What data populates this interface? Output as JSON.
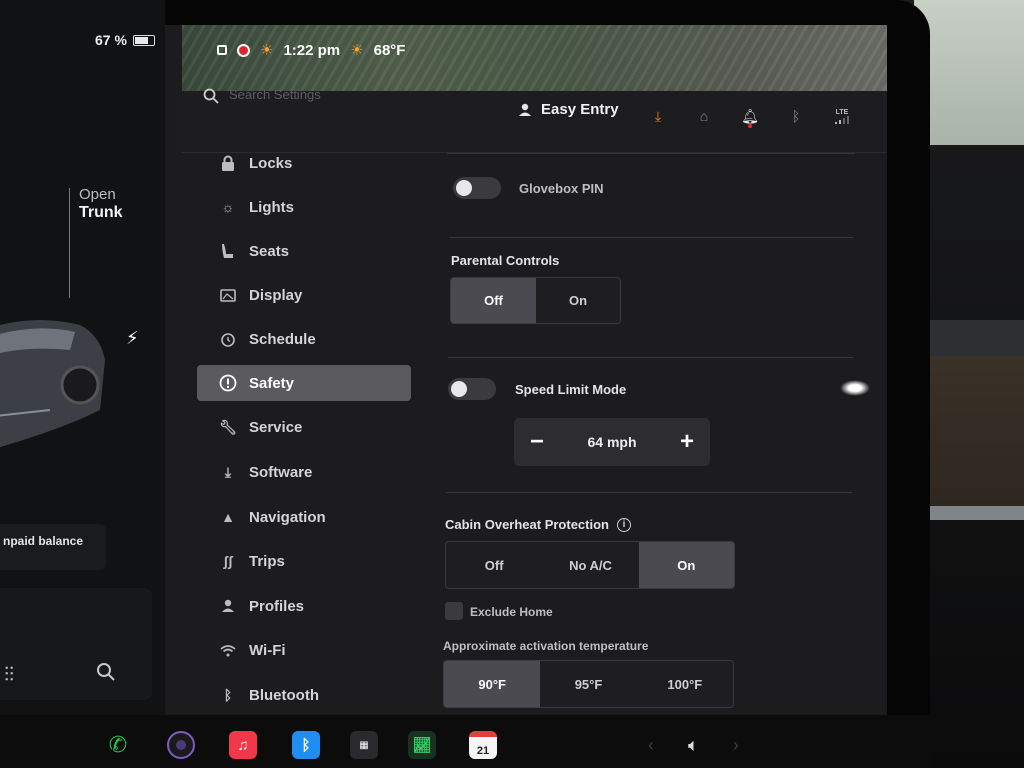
{
  "status": {
    "time": "1:22 pm",
    "temperature": "68°F",
    "battery": "67 %"
  },
  "car": {
    "trunk_open": "Open",
    "trunk_label": "Trunk",
    "unpaid": "npaid balance"
  },
  "settings": {
    "search_placeholder": "Search Settings",
    "profile_name": "Easy Entry",
    "lte": "LTE"
  },
  "sidebar": {
    "items": [
      {
        "label": "Locks",
        "icon": "lock-icon"
      },
      {
        "label": "Lights",
        "icon": "light-icon"
      },
      {
        "label": "Seats",
        "icon": "seat-icon"
      },
      {
        "label": "Display",
        "icon": "display-icon"
      },
      {
        "label": "Schedule",
        "icon": "schedule-icon"
      },
      {
        "label": "Safety",
        "icon": "alert-icon",
        "active": true
      },
      {
        "label": "Service",
        "icon": "wrench-icon"
      },
      {
        "label": "Software",
        "icon": "download-icon"
      },
      {
        "label": "Navigation",
        "icon": "navigation-icon"
      },
      {
        "label": "Trips",
        "icon": "trips-icon"
      },
      {
        "label": "Profiles",
        "icon": "profile-icon"
      },
      {
        "label": "Wi-Fi",
        "icon": "wifi-icon"
      },
      {
        "label": "Bluetooth",
        "icon": "bluetooth-icon"
      }
    ]
  },
  "content": {
    "glovebox_pin": "Glovebox PIN",
    "parental_controls": {
      "title": "Parental Controls",
      "options": [
        "Off",
        "On"
      ],
      "selected": "Off"
    },
    "speed_limit": {
      "label": "Speed Limit Mode",
      "minus": "−",
      "value": "64 mph",
      "plus": "+"
    },
    "cabin_overheat": {
      "title": "Cabin Overheat Protection",
      "info": "i",
      "options": [
        "Off",
        "No A/C",
        "On"
      ],
      "selected": "On"
    },
    "exclude_home": "Exclude Home",
    "activation_temp": {
      "title": "Approximate activation temperature",
      "options": [
        "90°F",
        "95°F",
        "100°F"
      ],
      "selected": "90°F"
    }
  },
  "dock": {
    "calendar_day": "21"
  },
  "colors": {
    "accent_orange": "#f07a1a",
    "active_item": "#5a5a5f",
    "record_red": "#e5232f"
  }
}
